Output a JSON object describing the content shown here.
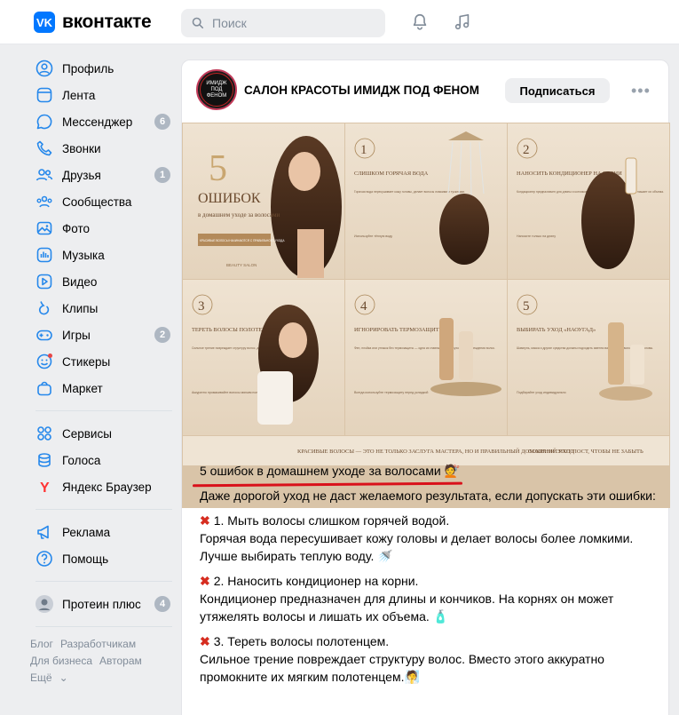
{
  "header": {
    "logo_mark": "VK",
    "logo_text": "вконтакте",
    "search_placeholder": "Поиск",
    "icons": [
      "search-icon",
      "bell-icon",
      "music-icon"
    ]
  },
  "sidebar": {
    "items": [
      {
        "label": "Профиль",
        "icon": "profile-icon"
      },
      {
        "label": "Лента",
        "icon": "feed-icon"
      },
      {
        "label": "Мессенджер",
        "icon": "messenger-icon",
        "badge": "6"
      },
      {
        "label": "Звонки",
        "icon": "phone-icon"
      },
      {
        "label": "Друзья",
        "icon": "friends-icon",
        "badge": "1"
      },
      {
        "label": "Сообщества",
        "icon": "communities-icon"
      },
      {
        "label": "Фото",
        "icon": "photo-icon"
      },
      {
        "label": "Музыка",
        "icon": "music-icon"
      },
      {
        "label": "Видео",
        "icon": "video-icon"
      },
      {
        "label": "Клипы",
        "icon": "clips-icon"
      },
      {
        "label": "Игры",
        "icon": "games-icon",
        "badge": "2"
      },
      {
        "label": "Стикеры",
        "icon": "stickers-icon"
      },
      {
        "label": "Маркет",
        "icon": "market-icon"
      }
    ],
    "items2": [
      {
        "label": "Сервисы",
        "icon": "services-icon"
      },
      {
        "label": "Голоса",
        "icon": "votes-icon"
      },
      {
        "label": "Яндекс Браузер",
        "icon": "yandex-icon"
      }
    ],
    "items3": [
      {
        "label": "Реклама",
        "icon": "ads-icon"
      },
      {
        "label": "Помощь",
        "icon": "help-icon"
      }
    ],
    "items4": [
      {
        "label": "Протеин плюс",
        "icon": "group-avatar-icon",
        "badge": "4"
      }
    ],
    "footer": {
      "blog": "Блог",
      "developers": "Разработчикам",
      "business": "Для бизнеса",
      "authors": "Авторам",
      "more": "Ещё"
    }
  },
  "post": {
    "group_name": "САЛОН КРАСОТЫ ИМИДЖ ПОД ФЕНОМ",
    "avatar_text": "ИМИДЖ ПОД ФЕНОМ",
    "subscribe_label": "Подписаться",
    "more_label": "•••",
    "image": {
      "title_num": "5",
      "title_word": "ОШИБОК",
      "title_sub": "в домашнем уходе за волосами",
      "tag": "КРАСИВЫЕ ВОЛОСЫ НАЧИНАЮТСЯ С ПРАВИЛЬНОГО УХОДА",
      "brand": "BEAUTY SALON",
      "tips": [
        {
          "num": "1",
          "title": "СЛИШКОМ ГОРЯЧАЯ ВОДА",
          "desc": "Горячая вода пересушивает кожу головы, делает волосы ломкими и тусклыми.",
          "hint": "Используйте тёплую воду"
        },
        {
          "num": "2",
          "title": "НАНОСИТЬ КОНДИЦИОНЕР НА КОРНИ",
          "desc": "Кондиционер предназначен для длины и кончиков. На корнях он утяжеляет волосы и лишает их объема.",
          "hint": "Наносите только на длину"
        },
        {
          "num": "3",
          "title": "ТЕРЕТЬ ВОЛОСЫ ПОЛОТЕНЦЕМ",
          "desc": "Сильное трение повреждает структуру волос, делает их пушистыми и ломкими.",
          "hint": "Аккуратно промакивайте волосы мягким полотенцем"
        },
        {
          "num": "4",
          "title": "ИГНОРИРОВАТЬ ТЕРМОЗАЩИТУ",
          "desc": "Фен, плойка или утюжок без термозащиты — одна из главных причин сухости и повреждения волос.",
          "hint": "Всегда используйте термозащиту перед укладкой"
        },
        {
          "num": "5",
          "title": "ВЫБИРАТЬ УХОД «НАОУГАД»",
          "desc": "Шампунь, маска и другие средства должны подходить именно вашему типу волос и кожи головы.",
          "hint": "Подбирайте уход индивидуально"
        }
      ],
      "bottom_left": "КРАСИВЫЕ ВОЛОСЫ — ЭТО НЕ ТОЛЬКО ЗАСЛУГА МАСТЕРА, НО И ПРАВИЛЬНЫЙ ДОМАШНИЙ УХОД",
      "bottom_right": "СОХРАНИ ЭТОТ ПОСТ, ЧТОБЫ НЕ ЗАБЫТЬ"
    },
    "title": "5 ошибок в домашнем уходе за волосами",
    "title_emoji": "💇",
    "intro": "Даже дорогой уход не даст желаемого результата, если допускать эти ошибки:",
    "items": [
      {
        "mark": "✖",
        "head": "1. Мыть волосы слишком горячей водой.",
        "body": "Горячая вода пересушивает кожу головы и делает волосы более ломкими. Лучше выбирать теплую воду. 🚿"
      },
      {
        "mark": "✖",
        "head": "2. Наносить кондиционер на корни.",
        "body": "Кондиционер предназначен для длины и кончиков. На корнях он может утяжелять волосы и лишать их объема. 🧴"
      },
      {
        "mark": "✖",
        "head": "3. Тереть волосы полотенцем.",
        "body": "Сильное трение повреждает структуру волос. Вместо этого аккуратно промокните их мягким полотенцем.🧖"
      }
    ]
  }
}
